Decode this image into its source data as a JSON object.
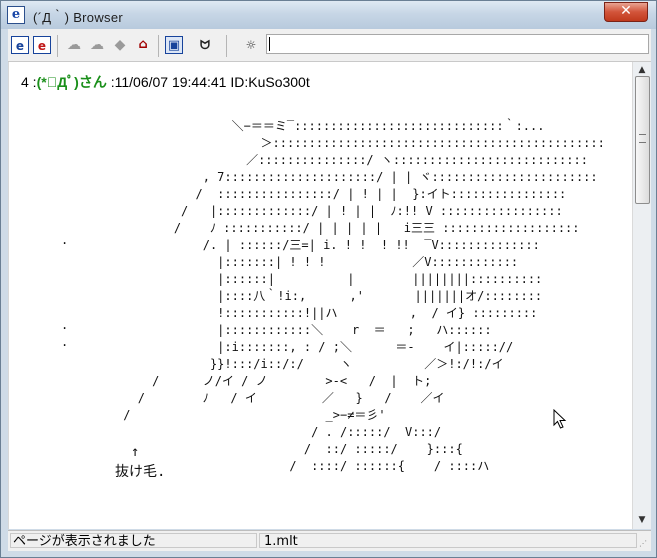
{
  "window": {
    "title": "(´Д｀) Browser",
    "close_glyph": "✕",
    "app_icon_glyph": "e"
  },
  "toolbar": {
    "buttons": [
      {
        "name": "browser-e-icon",
        "glyph": "e"
      },
      {
        "name": "browser-e-red-icon",
        "glyph": "e"
      },
      {
        "name": "back-icon",
        "glyph": "☁"
      },
      {
        "name": "forward-icon",
        "glyph": "☁"
      },
      {
        "name": "stop-icon",
        "glyph": "◆"
      },
      {
        "name": "home-icon",
        "glyph": "⌂"
      },
      {
        "name": "window-icon",
        "glyph": "▣"
      },
      {
        "name": "cat-face-icon",
        "glyph": "ᗢ"
      },
      {
        "name": "settings-cat-icon",
        "glyph": "☼"
      }
    ],
    "address_value": ""
  },
  "post": {
    "number": "4",
    "separator": " :",
    "name": "(*ﾟДﾟ)さん",
    "date": " :11/06/07 19:44:41 ID:KuSo300t"
  },
  "ascii_art": {
    "main": "                         ＼−＝＝ミ‾:::::::::::::::::::::::::::::｀:...\n                             ＞::::::::::::::::::::::::::::::::::::::::::::::\n                           ／:::::::::::::::/ ヽ:::::::::::::::::::::::::::\n                     , 7:::::::::::::::::::::/ | | ヾ:::::::::::::::::::::::\n                    /  ::::::::::::::::/ | ! | |  }:イト::::::::::::::::\n                  /   |:::::::::::::/ | ! | |  ﾉ:!! V :::::::::::::::::\n                 /    ﾉ :::::::::::/ | | | | |   i三三 :::::::::::::::::::\n                     /. | ::::::/三=| i. ! !  ! !!  ‾V::::::::::::::\n                       |:::::::| ! ! !            ／V::::::::::::\n                       |::::::|          |        ||||||||::::::::::\n                       |::::八｀!i:,      ,'       |||||||オ/::::::::\n                       !:::::::::::!||ハ          ,  / イ} :::::::::\n                       |::::::::::::＼    r  ＝   ;   ハ::::::\n                       |:i:::::::, : / ;＼      ＝-    イ|::::://\n                      }}!:::/i::/:/     ヽ          ／＞!:/!:/イ\n              /      ノ/イ / ノ        >-<   /  |  ト;\n            /        ﾉ   / イ         ／   }   /    ／イ\n          /                           _>−≠＝彡'\n                                    / . /:::::/  V:::/\n                                   /  ::/ :::::/    }:::{\n                                 /  ::::/ ::::::{    / ::::ハ",
    "margin_dots": "\n\n\n\n\n\n\n\n\n.\n\n\n\n\n.\n.",
    "arrow": "↑",
    "label": "抜け毛."
  },
  "statusbar": {
    "message": "ページが表示されました",
    "file": "1.mlt"
  }
}
